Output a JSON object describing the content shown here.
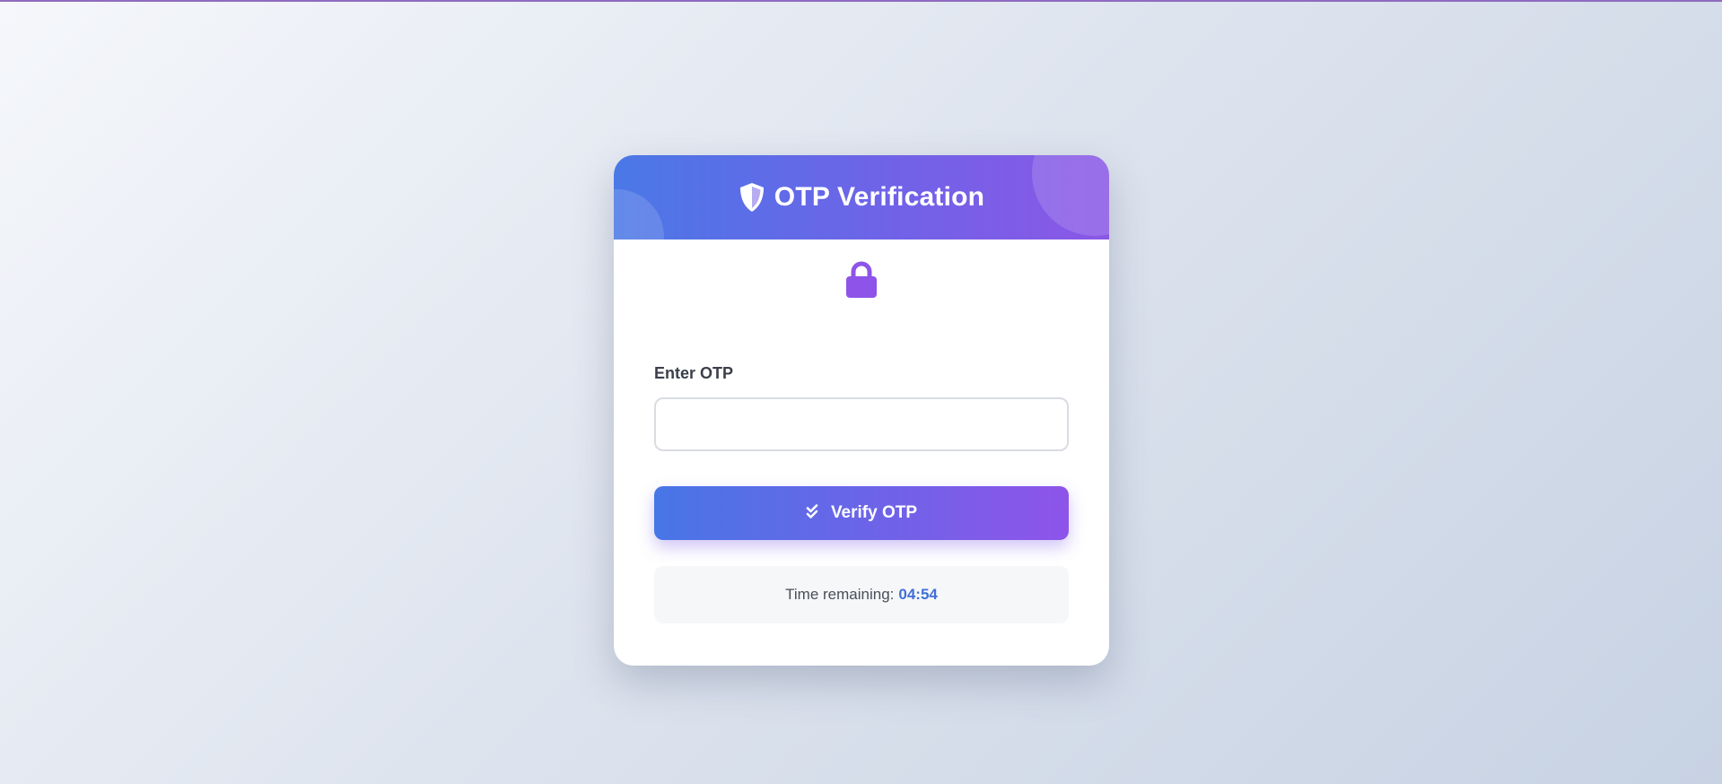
{
  "header": {
    "title": "OTP Verification",
    "icon": "shield-icon"
  },
  "lock": {
    "icon": "lock-icon",
    "color": "#8e54e9"
  },
  "form": {
    "label": "Enter OTP",
    "otp_value": "",
    "otp_placeholder": ""
  },
  "verify_button": {
    "label": "Verify OTP",
    "icon": "double-check-icon"
  },
  "timer": {
    "label": "Time remaining:",
    "value": "04:54"
  },
  "colors": {
    "gradient_start": "#4776e6",
    "gradient_end": "#8e54e9",
    "timer_accent": "#3f6fd8"
  }
}
